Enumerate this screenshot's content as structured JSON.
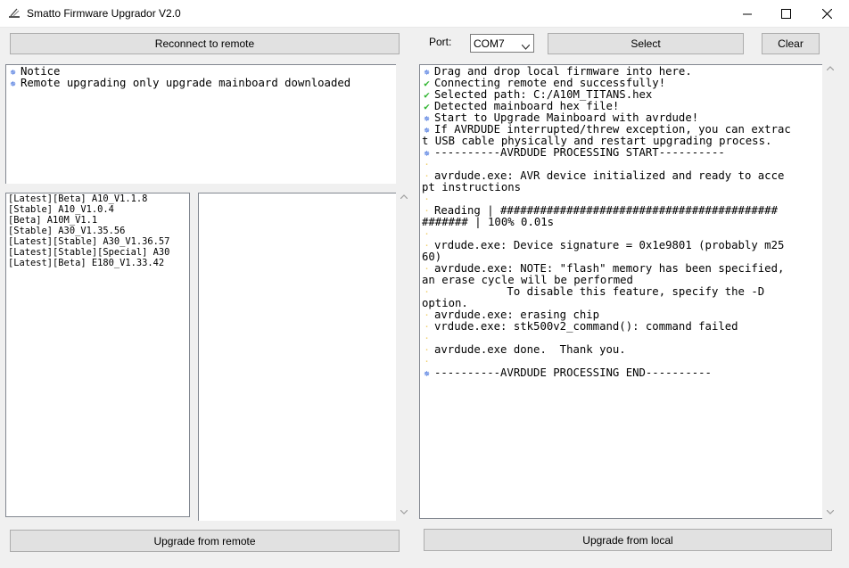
{
  "window": {
    "title": "Smatto Firmware Upgrador V2.0"
  },
  "left": {
    "reconnect_label": "Reconnect to remote",
    "notice_lines": [
      "Notice",
      "Remote upgrading only upgrade mainboard downloaded"
    ],
    "firmware_list": [
      "[Latest][Beta] A10_V1.1.8",
      "[Stable] A10_V1.0.4",
      "[Beta] A10M_V1.1",
      "[Stable] A30_V1.35.56",
      "[Latest][Stable] A30_V1.36.57",
      "[Latest][Stable][Special] A30",
      "[Latest][Beta] E180_V1.33.42"
    ],
    "upgrade_remote_label": "Upgrade from remote"
  },
  "right": {
    "port_label": "Port:",
    "port_value": "COM7",
    "select_label": "Select",
    "clear_label": "Clear",
    "upgrade_local_label": "Upgrade from local",
    "log": [
      {
        "icon": "info",
        "text": "Drag and drop local firmware into here."
      },
      {
        "icon": "ok",
        "text": "Connecting remote end successfully!"
      },
      {
        "icon": "ok",
        "text": "Selected path: C:/A10M_TITANS.hex"
      },
      {
        "icon": "ok",
        "text": "Detected mainboard hex file!"
      },
      {
        "icon": "info",
        "text": "Start to Upgrade Mainboard with avrdude!"
      },
      {
        "icon": "info",
        "text": "If AVRDUDE interrupted/threw exception, you can extrac"
      },
      {
        "icon": "none",
        "text": "t USB cable physically and restart upgrading process."
      },
      {
        "icon": "info",
        "text": "----------AVRDUDE PROCESSING START----------"
      },
      {
        "icon": "dot",
        "text": ""
      },
      {
        "icon": "dot",
        "text": "avrdude.exe: AVR device initialized and ready to acce"
      },
      {
        "icon": "none",
        "text": "pt instructions"
      },
      {
        "icon": "dot",
        "text": ""
      },
      {
        "icon": "dot",
        "text": "Reading | ##########################################"
      },
      {
        "icon": "none",
        "text": "####### | 100% 0.01s"
      },
      {
        "icon": "dot",
        "text": ""
      },
      {
        "icon": "dot",
        "text": "vrdude.exe: Device signature = 0x1e9801 (probably m25"
      },
      {
        "icon": "none",
        "text": "60)"
      },
      {
        "icon": "dot",
        "text": "avrdude.exe: NOTE: \"flash\" memory has been specified,"
      },
      {
        "icon": "none",
        "text": "an erase cycle will be performed"
      },
      {
        "icon": "dot",
        "text": "           To disable this feature, specify the -D"
      },
      {
        "icon": "none",
        "text": "option."
      },
      {
        "icon": "dot",
        "text": "avrdude.exe: erasing chip"
      },
      {
        "icon": "dot",
        "text": "vrdude.exe: stk500v2_command(): command failed"
      },
      {
        "icon": "dot",
        "text": ""
      },
      {
        "icon": "dot",
        "text": "avrdude.exe done.  Thank you."
      },
      {
        "icon": "dot",
        "text": ""
      },
      {
        "icon": "info",
        "text": "----------AVRDUDE PROCESSING END----------"
      }
    ]
  },
  "colors": {
    "info_icon": "#2b5fd9",
    "ok_icon": "#2fb52f",
    "dot_icon": "#f0d070",
    "button_face": "#e1e1e1",
    "window_bg": "#f0f0f0"
  }
}
